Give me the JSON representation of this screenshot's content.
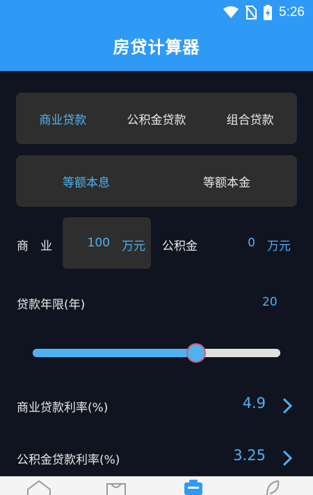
{
  "status_bar": {
    "time": "5:26"
  },
  "app": {
    "title": "房贷计算器"
  },
  "loan_type_tabs": [
    {
      "label": "商业贷款",
      "active": true
    },
    {
      "label": "公积金贷款",
      "active": false
    },
    {
      "label": "组合贷款",
      "active": false
    }
  ],
  "repayment_tabs": [
    {
      "label": "等额本息",
      "active": true
    },
    {
      "label": "等额本金",
      "active": false
    }
  ],
  "amounts": {
    "commercial_label": "商　业",
    "commercial_value": "100",
    "commercial_unit": "万元",
    "fund_label": "公积金",
    "fund_value": "0",
    "fund_unit": "万元"
  },
  "term": {
    "label": "贷款年限(年)",
    "value": "20",
    "slider_fraction": 0.66
  },
  "rates": {
    "commercial_label": "商业贷款利率(%)",
    "commercial_value": "4.9",
    "fund_label": "公积金贷款利率(%)",
    "fund_value": "3.25"
  },
  "colors": {
    "accent": "#2f9af5",
    "highlight": "#4fb2f0",
    "background": "#0f1420",
    "panel": "#2e2e2e"
  },
  "bottom_nav": [
    {
      "icon": "home-icon",
      "active": false
    },
    {
      "icon": "bag-icon",
      "active": false
    },
    {
      "icon": "calculator-icon",
      "active": true
    },
    {
      "icon": "leaf-icon",
      "active": false
    }
  ]
}
